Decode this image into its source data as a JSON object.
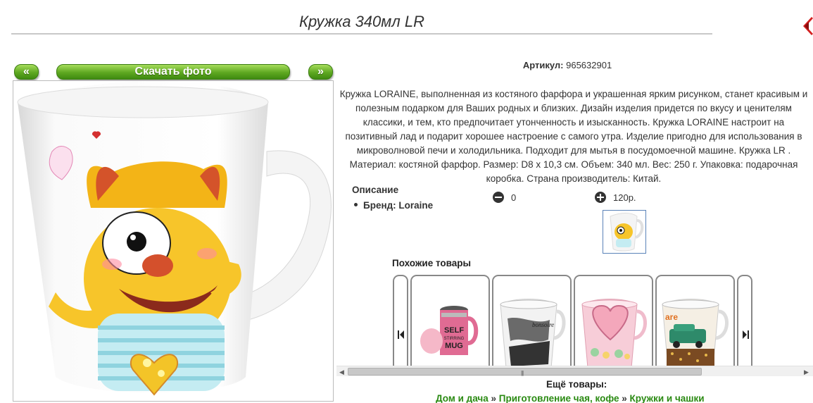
{
  "product": {
    "title": "Кружка 340мл LR",
    "article_label": "Артикул:",
    "article_value": "965632901",
    "description": "Кружка LORAINE, выполненная из костяного фарфора и украшенная ярким рисунком, станет красивым и полезным подарком для Ваших родных и близких. Дизайн изделия придется по вкусу и ценителям классики, и тем, кто предпочитает утонченность и изысканность. Кружка LORAINE настроит на позитивный лад и подарит хорошее настроение с самого утра. Изделие пригодно для использования в микроволновой печи и холодильника. Подходит для мытья в посудомоечной машине. Кружка LR . Материал: костяной фарфор. Размер: D8 x 10,3 см. Объем: 340 мл. Вес: 250 г. Упаковка: подарочная коробка. Страна производитель: Китай.",
    "spec_title": "Описание",
    "spec_brand": "Бренд: Loraine"
  },
  "gallery": {
    "prev_label": "«",
    "download_label": "Скачать фото",
    "next_label": "»"
  },
  "votes": {
    "minus_value": "0",
    "plus_value": "120р."
  },
  "similar": {
    "title": "Похожие товары",
    "items": [
      {
        "icon": "self-stirring-mug"
      },
      {
        "icon": "espresso-print-mug"
      },
      {
        "icon": "pink-heart-mug"
      },
      {
        "icon": "car-print-mug"
      }
    ]
  },
  "more": {
    "title": "Ещё товары:",
    "crumbs": [
      "Дом и дача",
      "Приготовление чая, кофе",
      "Кружки и чашки"
    ],
    "separator": "»"
  },
  "colors": {
    "accent_green": "#5ea821",
    "link_green": "#2a8a12",
    "close_red": "#d42020"
  }
}
